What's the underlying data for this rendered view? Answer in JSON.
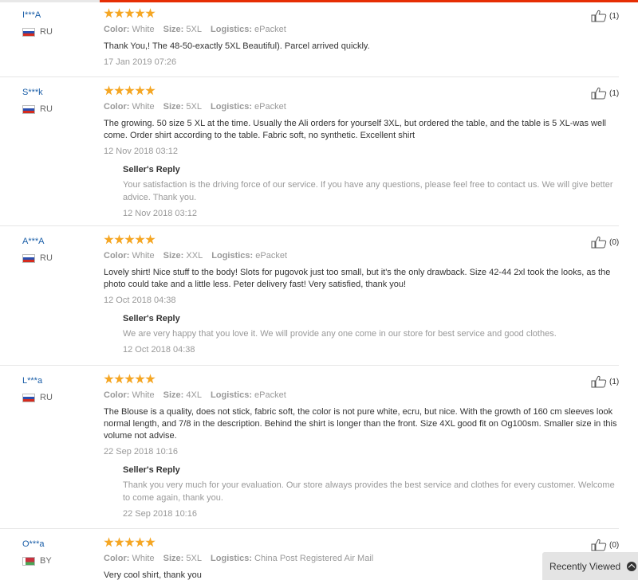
{
  "reviews": [
    {
      "user": "I***A",
      "country": "RU",
      "flag": "ru",
      "attrs": {
        "color_label": "Color:",
        "color": "White",
        "size_label": "Size:",
        "size": "5XL",
        "logistics_label": "Logistics:",
        "logistics": "ePacket"
      },
      "text": "Thank You,! The 48-50-exactly 5XL Beautiful). Parcel arrived quickly.",
      "date": "17 Jan 2019 07:26",
      "helpful": "(1)",
      "reply": null
    },
    {
      "user": "S***k",
      "country": "RU",
      "flag": "ru",
      "attrs": {
        "color_label": "Color:",
        "color": "White",
        "size_label": "Size:",
        "size": "5XL",
        "logistics_label": "Logistics:",
        "logistics": "ePacket"
      },
      "text": "The growing. 50 size 5 XL at the time. Usually the Ali orders for yourself 3XL, but ordered the table, and the table is 5 XL-was well come. Order shirt according to the table. Fabric soft, no synthetic. Excellent shirt",
      "date": "12 Nov 2018 03:12",
      "helpful": "(1)",
      "reply": {
        "title": "Seller's Reply",
        "text": "Your satisfaction is the driving force of our service. If you have any questions, please feel free to contact us. We will give better advice. Thank you.",
        "date": "12 Nov 2018 03:12"
      }
    },
    {
      "user": "A***A",
      "country": "RU",
      "flag": "ru",
      "attrs": {
        "color_label": "Color:",
        "color": "White",
        "size_label": "Size:",
        "size": "XXL",
        "logistics_label": "Logistics:",
        "logistics": "ePacket"
      },
      "text": "Lovely shirt! Nice stuff to the body! Slots for pugovok just too small, but it's the only drawback. Size 42-44 2xl took the looks, as the photo could take and a little less. Peter delivery fast! Very satisfied, thank you!",
      "date": "12 Oct 2018 04:38",
      "helpful": "(0)",
      "reply": {
        "title": "Seller's Reply",
        "text": "We are very happy that you love it. We will provide any one come in our store for best service and good clothes.",
        "date": "12 Oct 2018 04:38"
      }
    },
    {
      "user": "L***a",
      "country": "RU",
      "flag": "ru",
      "attrs": {
        "color_label": "Color:",
        "color": "White",
        "size_label": "Size:",
        "size": "4XL",
        "logistics_label": "Logistics:",
        "logistics": "ePacket"
      },
      "text": "The Blouse is a quality, does not stick, fabric soft, the color is not pure white, ecru, but nice. With the growth of 160 cm sleeves look normal length, and 7/8 in the description. Behind the shirt is longer than the front. Size 4XL good fit on Og100sm. Smaller size in this volume not advise.",
      "date": "22 Sep 2018 10:16",
      "helpful": "(1)",
      "reply": {
        "title": "Seller's Reply",
        "text": "Thank you very much for your evaluation. Our store always provides the best service and clothes for every customer. Welcome to come again, thank you.",
        "date": "22 Sep 2018 10:16"
      }
    },
    {
      "user": "O***a",
      "country": "BY",
      "flag": "by",
      "attrs": {
        "color_label": "Color:",
        "color": "White",
        "size_label": "Size:",
        "size": "5XL",
        "logistics_label": "Logistics:",
        "logistics": "China Post Registered Air Mail"
      },
      "text": "Very cool shirt, thank you",
      "date": "",
      "helpful": "(0)",
      "reply": null
    }
  ],
  "recently_viewed": {
    "label": "Recently Viewed",
    "icon": "chevron-up-circle-icon"
  },
  "colors": {
    "accent": "#e62e04",
    "star": "#f5a623",
    "link": "#1a5ea8"
  }
}
